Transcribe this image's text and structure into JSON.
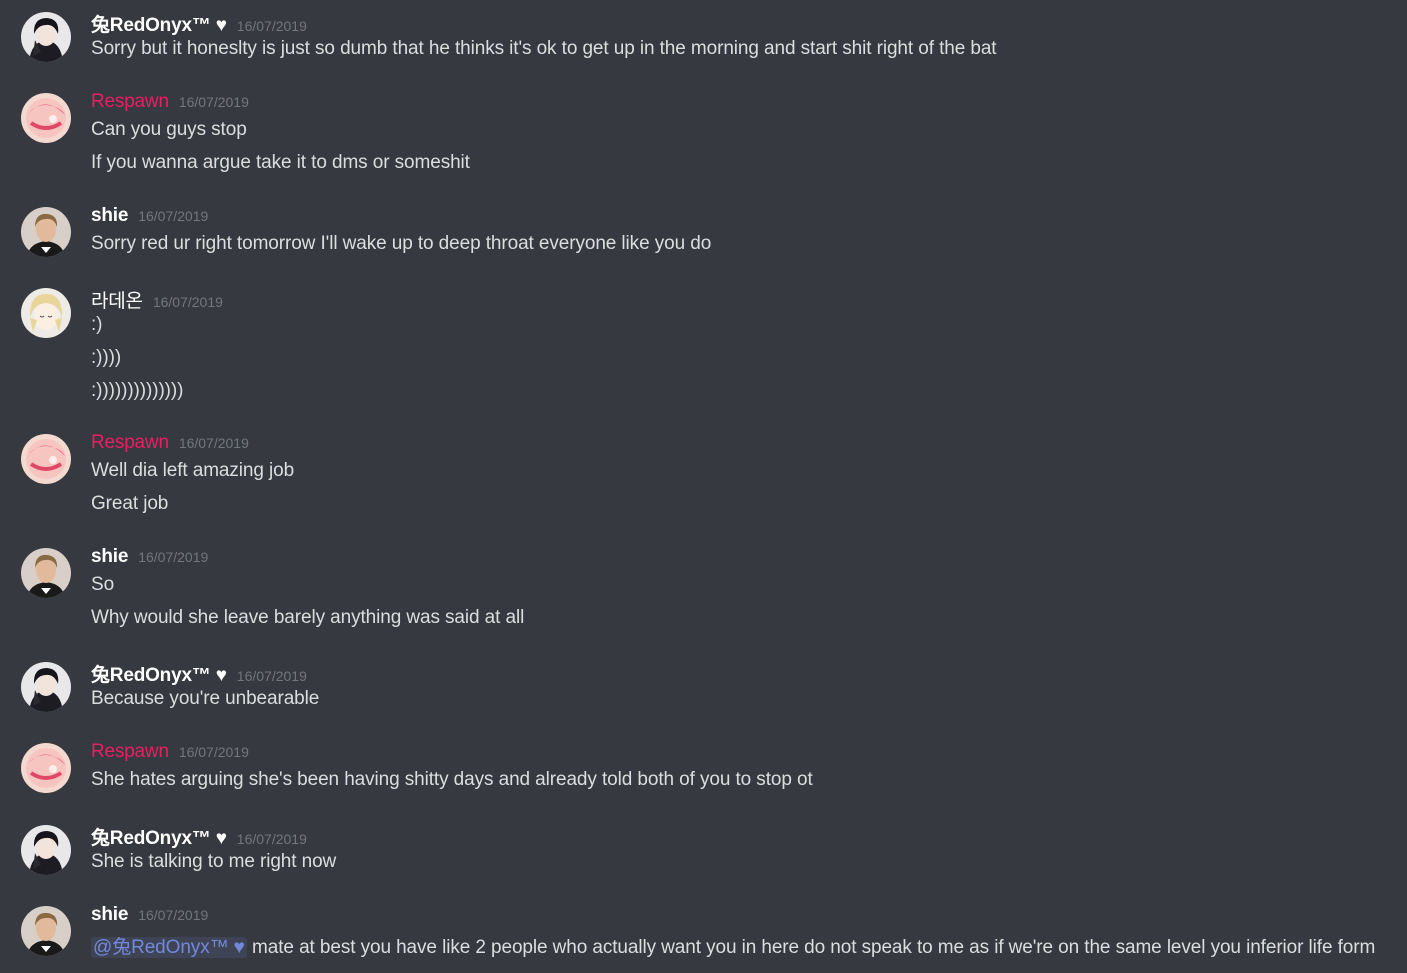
{
  "messages": [
    {
      "author": "兔RedOnyx™ ♥",
      "author_color": "#ffffff",
      "avatar": "dark-hair-boy-avatar",
      "timestamp": "16/07/2019",
      "lines": [
        "Sorry but it honeslty is just so dumb that he thinks it's ok to get up in the morning and start shit right of the bat"
      ]
    },
    {
      "author": "Respawn",
      "author_color": "#e91e63",
      "avatar": "pink-anime-avatar",
      "timestamp": "16/07/2019",
      "lines": [
        "Can you guys stop",
        "If you wanna argue take it to dms or someshit"
      ]
    },
    {
      "author": "shie",
      "author_color": "#ffffff",
      "avatar": "young-man-photo-avatar",
      "timestamp": "16/07/2019",
      "lines": [
        "Sorry red ur right tomorrow I'll wake up to deep throat everyone like you do"
      ]
    },
    {
      "author": "라데온",
      "author_color": "#ffffff",
      "avatar": "blonde-anime-avatar",
      "timestamp": "16/07/2019",
      "lines": [
        ":)",
        ":))))",
        ":))))))))))))))"
      ]
    },
    {
      "author": "Respawn",
      "author_color": "#e91e63",
      "avatar": "pink-anime-avatar",
      "timestamp": "16/07/2019",
      "lines": [
        "Well dia left amazing job",
        "Great job"
      ]
    },
    {
      "author": "shie",
      "author_color": "#ffffff",
      "avatar": "young-man-photo-avatar",
      "timestamp": "16/07/2019",
      "lines": [
        "So",
        "Why would she leave barely anything was said at all"
      ]
    },
    {
      "author": "兔RedOnyx™ ♥",
      "author_color": "#ffffff",
      "avatar": "dark-hair-boy-avatar",
      "timestamp": "16/07/2019",
      "lines": [
        "Because you're unbearable"
      ]
    },
    {
      "author": "Respawn",
      "author_color": "#e91e63",
      "avatar": "pink-anime-avatar",
      "timestamp": "16/07/2019",
      "lines": [
        "She hates arguing she's been having shitty days and already told both of you to stop ot"
      ]
    },
    {
      "author": "兔RedOnyx™ ♥",
      "author_color": "#ffffff",
      "avatar": "dark-hair-boy-avatar",
      "timestamp": "16/07/2019",
      "lines": [
        "She is talking to me right now"
      ]
    },
    {
      "author": "shie",
      "author_color": "#ffffff",
      "avatar": "young-man-photo-avatar",
      "timestamp": "16/07/2019",
      "mention": "@兔RedOnyx™ ♥",
      "lines": [
        "mate at best you have like 2 people who actually want you in here do not speak to me as if we're on the same level you inferior life form"
      ]
    }
  ],
  "colors": {
    "background": "#36393f",
    "text": "#dcddde",
    "timestamp": "#72767d",
    "mention": "#7289da"
  }
}
